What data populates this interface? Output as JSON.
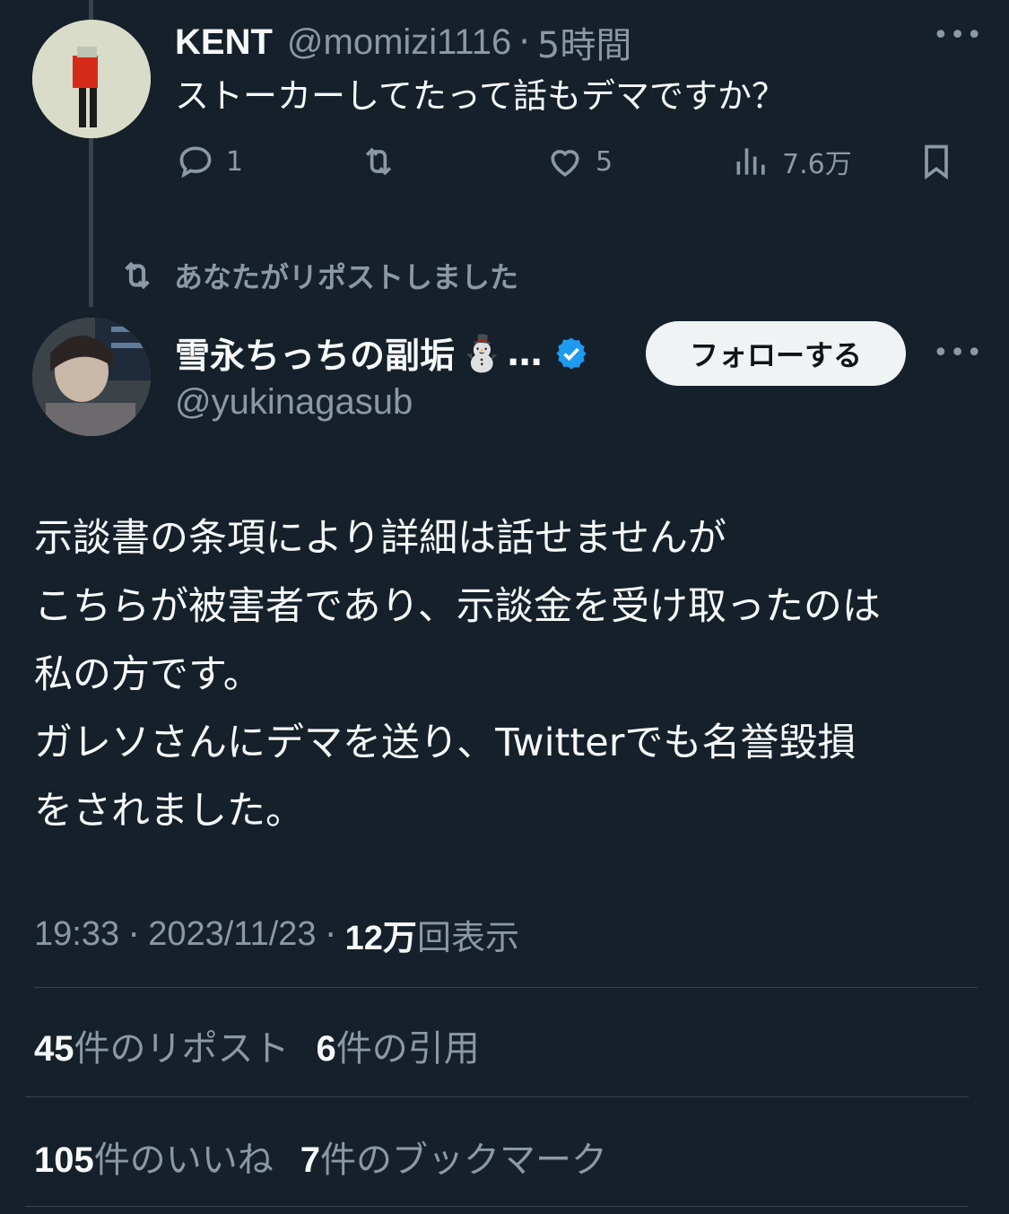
{
  "parent_tweet": {
    "display_name": "KENT",
    "handle": "@momizi1116",
    "separator": "·",
    "time": "5時間",
    "text": "ストーカーしてたって話もデマですか？",
    "reply_count": "1",
    "like_count": "5",
    "view_count": "7.6万",
    "more": "•••"
  },
  "repost_notice": "あなたがリポストしました",
  "main_tweet": {
    "display_name": "雪永ちっちの副垢",
    "emoji": "⛄",
    "ellipsis": "…",
    "handle": "@yukinagasub",
    "follow_label": "フォローする",
    "more": "•••",
    "text": "示談書の条項により詳細は話せませんが\nこちらが被害者であり、示談金を受け取ったのは\n私の方です。\nガレソさんにデマを送り、Twitterでも名誉毀損\nをされました。",
    "timestamp": "19:33",
    "sep1": "·",
    "date": "2023/11/23",
    "sep2": "·",
    "views_num": "12万",
    "views_label": "回表示"
  },
  "stats": {
    "reposts_num": "45",
    "reposts_label": "件のリポスト",
    "quotes_num": "6",
    "quotes_label": "件の引用",
    "likes_num": "105",
    "likes_label": "件のいいね",
    "bookmarks_num": "7",
    "bookmarks_label": "件のブックマーク"
  },
  "colors": {
    "background": "#15202b",
    "muted_text": "#8b98a5",
    "verified_blue": "#1d9bf0",
    "divider": "#38444d"
  },
  "icons": [
    "reply-icon",
    "retweet-icon",
    "like-icon",
    "views-icon",
    "bookmark-icon",
    "verified-icon",
    "more-icon"
  ]
}
